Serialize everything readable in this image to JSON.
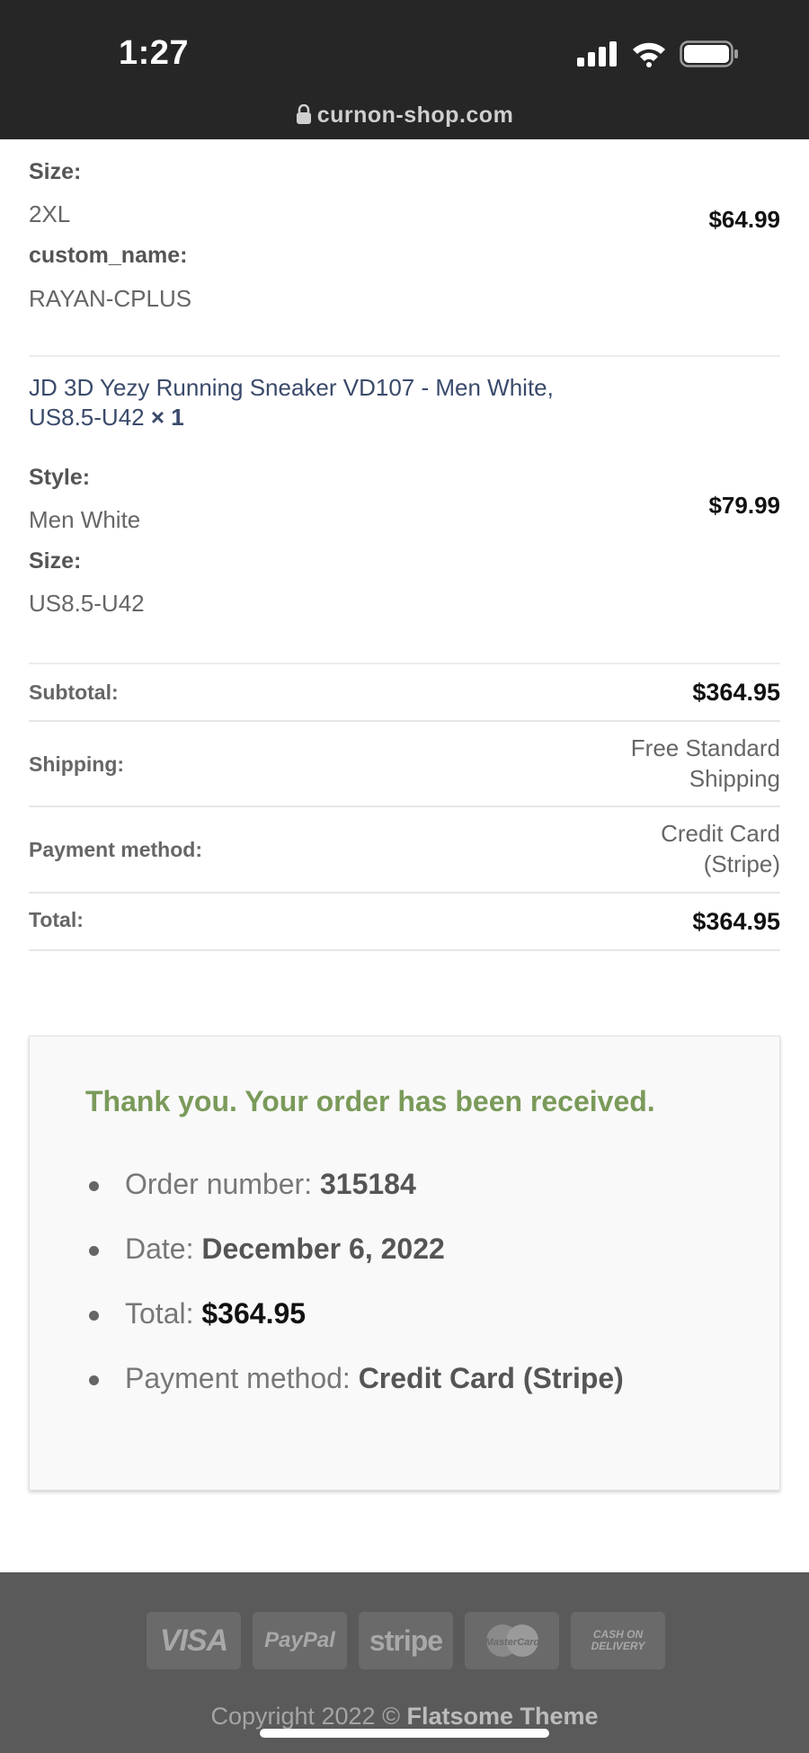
{
  "status_bar": {
    "time": "1:27"
  },
  "browser": {
    "url": "curnon-shop.com"
  },
  "products": [
    {
      "meta": [
        {
          "label": "Size:",
          "value": "2XL"
        },
        {
          "label": "custom_name:",
          "value": "RAYAN-CPLUS"
        }
      ],
      "price": "$64.99"
    },
    {
      "name": "JD 3D Yezy Running Sneaker VD107 - Men White, US8.5-U42",
      "quantity": "× 1",
      "meta": [
        {
          "label": "Style:",
          "value": "Men White"
        },
        {
          "label": "Size:",
          "value": "US8.5-U42"
        }
      ],
      "price": "$79.99"
    }
  ],
  "totals": {
    "subtotal_label": "Subtotal:",
    "subtotal_value": "$364.95",
    "shipping_label": "Shipping:",
    "shipping_value_line1": "Free Standard",
    "shipping_value_line2": "Shipping",
    "payment_label": "Payment method:",
    "payment_value_line1": "Credit Card",
    "payment_value_line2": "(Stripe)",
    "total_label": "Total:",
    "total_value": "$364.95"
  },
  "thank_you": {
    "title": "Thank you. Your order has been received.",
    "items": [
      {
        "label": "Order number: ",
        "value": "315184"
      },
      {
        "label": "Date: ",
        "value": "December 6, 2022"
      },
      {
        "label": "Total: ",
        "value": "$364.95"
      },
      {
        "label": "Payment method: ",
        "value": "Credit Card (Stripe)"
      }
    ]
  },
  "footer": {
    "payment_icons": [
      "VISA",
      "PayPal",
      "stripe",
      "MasterCard",
      "CASH ON",
      "DELIVERY"
    ],
    "copyright_prefix": "Copyright 2022 © ",
    "copyright_brand": "Flatsome Theme"
  },
  "colors": {
    "thank_you_title": "#7a9a5a",
    "top_bar": "#262626",
    "footer": "#5a5a5a"
  }
}
